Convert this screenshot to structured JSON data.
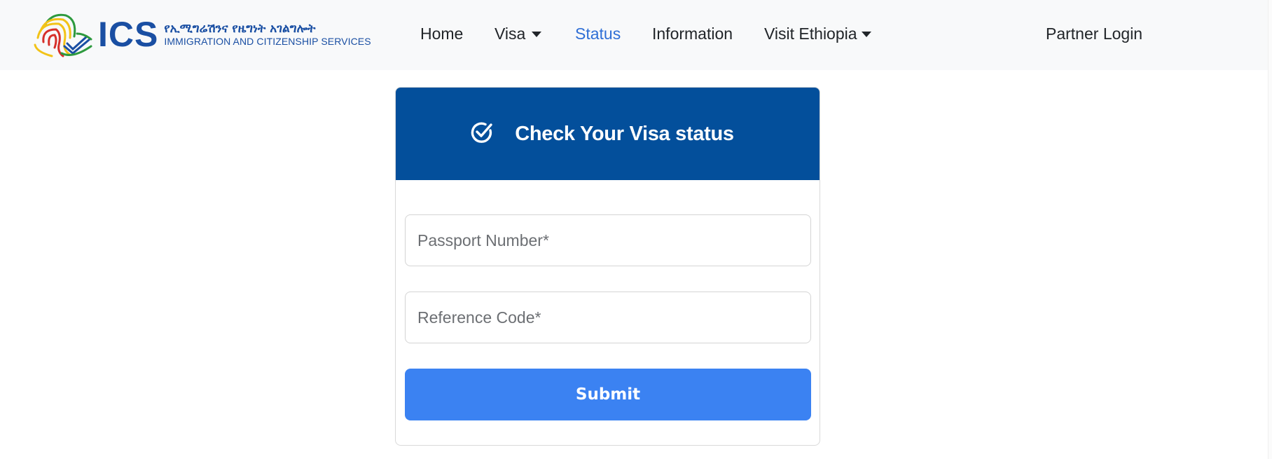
{
  "header": {
    "logo": {
      "abbr": "ICS",
      "amharic": "የኢሚግሬሽንና የዜግነት አገልግሎት",
      "english": "IMMIGRATION AND CITIZENSHIP SERVICES"
    },
    "nav": [
      {
        "label": "Home",
        "active": false,
        "dropdown": false
      },
      {
        "label": "Visa",
        "active": false,
        "dropdown": true
      },
      {
        "label": "Status",
        "active": true,
        "dropdown": false
      },
      {
        "label": "Information",
        "active": false,
        "dropdown": false
      },
      {
        "label": "Visit Ethiopia",
        "active": false,
        "dropdown": true
      }
    ],
    "partner_login": "Partner Login"
  },
  "status_card": {
    "icon": "circle-check-icon",
    "title": "Check Your Visa status",
    "passport": {
      "placeholder": "Passport Number*",
      "value": ""
    },
    "reference": {
      "placeholder": "Reference Code*",
      "value": ""
    },
    "submit_label": "Submit"
  },
  "colors": {
    "brand_blue": "#1a4fa3",
    "card_header": "#034f9b",
    "submit": "#3b82f2",
    "active_nav": "#2f6fd6",
    "logo_green": "#2e9a3e",
    "logo_yellow": "#f2c318",
    "logo_red": "#d6302a"
  }
}
